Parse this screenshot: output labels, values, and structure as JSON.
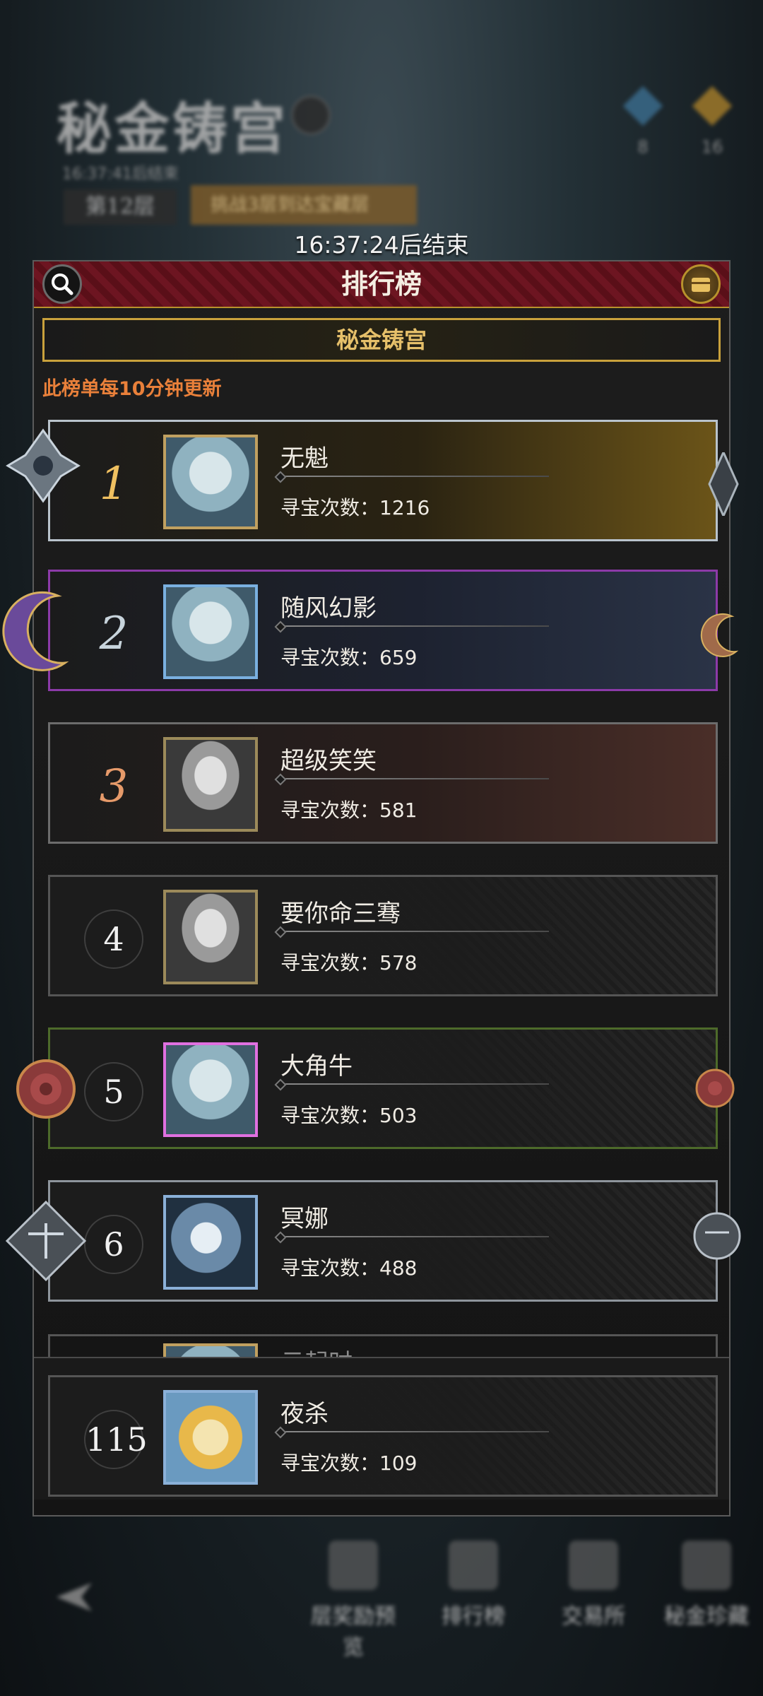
{
  "background": {
    "title": "秘金铸宫",
    "timer_small": "16:37:41后结束",
    "floor": "第12层",
    "tip": "挑战3层到达宝藏层",
    "resources": [
      {
        "icon": "blue-crystal-icon",
        "count": "8"
      },
      {
        "icon": "gold-star-icon",
        "count": "16"
      }
    ],
    "nav": [
      {
        "label": "层奖励预览",
        "icon": "reward-preview-icon"
      },
      {
        "label": "排行榜",
        "icon": "trophy-icon"
      },
      {
        "label": "交易所",
        "icon": "exchange-icon"
      },
      {
        "label": "秘金珍藏",
        "icon": "treasure-collection-icon"
      }
    ]
  },
  "timer": "16:37:24后结束",
  "panel": {
    "title": "排行榜",
    "tab": "秘金铸宫",
    "note": "此榜单每10分钟更新"
  },
  "score_label": "寻宝次数：",
  "rankings": [
    {
      "rank": "1",
      "name": "无魁",
      "score": "1216"
    },
    {
      "rank": "2",
      "name": "随风幻影",
      "score": "659"
    },
    {
      "rank": "3",
      "name": "超级笑笑",
      "score": "581"
    },
    {
      "rank": "4",
      "name": "要你命三骞",
      "score": "578"
    },
    {
      "rank": "5",
      "name": "大角牛",
      "score": "503"
    },
    {
      "rank": "6",
      "name": "冥娜",
      "score": "488"
    }
  ],
  "partial_row": {
    "name": "云起时"
  },
  "self": {
    "rank": "115",
    "name": "夜杀",
    "score": "109"
  }
}
